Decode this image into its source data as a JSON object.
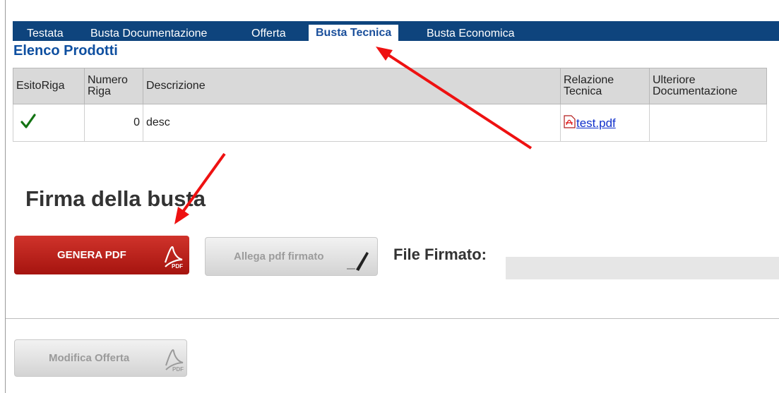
{
  "tabs": [
    {
      "label": "Testata"
    },
    {
      "label": "Busta Documentazione"
    },
    {
      "label": "Offerta"
    },
    {
      "label": "Busta Tecnica",
      "active": true
    },
    {
      "label": "Busta Economica"
    }
  ],
  "section_title": "Elenco Prodotti",
  "table": {
    "headers": {
      "esito": "EsitoRiga",
      "numero_line1": "Numero",
      "numero_line2": "Riga",
      "descrizione": "Descrizione",
      "relazione_line1": "Relazione",
      "relazione_line2": "Tecnica",
      "ulteriore_line1": "Ulteriore",
      "ulteriore_line2": "Documentazione"
    },
    "rows": [
      {
        "esito_icon": "checkmark-icon",
        "numero": "0",
        "descrizione": "desc",
        "relazione": "test.pdf",
        "ulteriore": ""
      }
    ]
  },
  "sign_title": "Firma della busta",
  "buttons": {
    "genera": "GENERA PDF",
    "allega": "Allega pdf firmato",
    "modifica": "Modifica Offerta"
  },
  "file_firmato_label": "File Firmato:",
  "file_firmato_value": "",
  "pdf_icon_text": "PDF",
  "icons": [
    "checkmark-icon",
    "pdf-file-icon",
    "pdf-icon",
    "pen-icon"
  ],
  "colors": {
    "tabbar": "#0e447d",
    "active_tab_text": "#1a4f9b",
    "title": "#0e4fa0",
    "genera_button": "#b8201a",
    "annotation_arrow": "#ee1111"
  }
}
